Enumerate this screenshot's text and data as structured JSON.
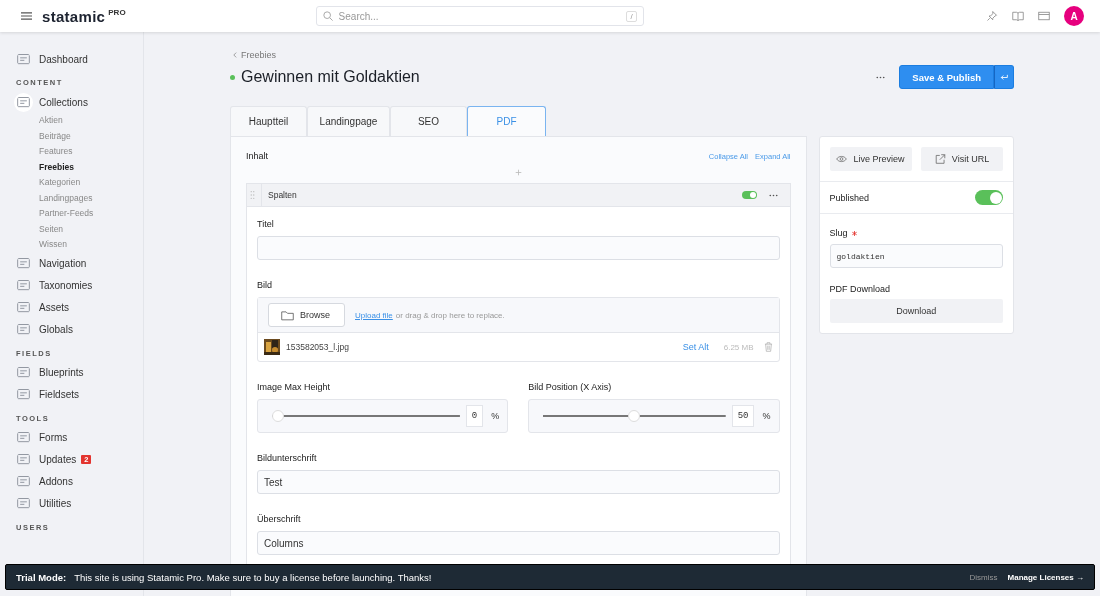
{
  "header": {
    "logo": "statamic",
    "logo_badge": "PRO",
    "search_placeholder": "Search...",
    "search_shortcut": "/",
    "avatar": "A"
  },
  "sidebar": {
    "sections": [
      {
        "items": [
          {
            "label": "Dashboard"
          }
        ]
      },
      {
        "heading": "CONTENT",
        "items": [
          {
            "label": "Collections",
            "expanded": true,
            "children": [
              {
                "label": "Aktien",
                "selected": false
              },
              {
                "label": "Beiträge",
                "selected": false
              },
              {
                "label": "Features",
                "selected": false
              },
              {
                "label": "Freebies",
                "selected": true
              },
              {
                "label": "Kategorien",
                "selected": false
              },
              {
                "label": "Landingpages",
                "selected": false
              },
              {
                "label": "Partner-Feeds",
                "selected": false
              },
              {
                "label": "Seiten",
                "selected": false
              },
              {
                "label": "Wissen",
                "selected": false
              }
            ]
          },
          {
            "label": "Navigation"
          },
          {
            "label": "Taxonomies"
          },
          {
            "label": "Assets"
          },
          {
            "label": "Globals"
          }
        ]
      },
      {
        "heading": "FIELDS",
        "items": [
          {
            "label": "Blueprints"
          },
          {
            "label": "Fieldsets"
          }
        ]
      },
      {
        "heading": "TOOLS",
        "items": [
          {
            "label": "Forms"
          },
          {
            "label": "Updates",
            "badge": "2"
          },
          {
            "label": "Addons"
          },
          {
            "label": "Utilities"
          }
        ]
      },
      {
        "heading": "USERS"
      }
    ]
  },
  "entry": {
    "breadcrumb": "Freebies",
    "title": "Gewinnen mit Goldaktien",
    "published": true,
    "save_label": "Save & Publish"
  },
  "tabs": [
    {
      "label": "Hauptteil",
      "selected": false
    },
    {
      "label": "Landingpage",
      "selected": false
    },
    {
      "label": "SEO",
      "selected": false
    },
    {
      "label": "PDF",
      "selected": true
    }
  ],
  "content": {
    "label": "Inhalt",
    "collapse": "Collapse All",
    "expand": "Expand All",
    "set": {
      "title": "Spalten",
      "enabled": true,
      "fields": [
        {
          "kind": "text",
          "label": "Titel"
        },
        {
          "kind": "assets",
          "label": "Bild",
          "browse": "Browse",
          "upload_link": "Upload file",
          "upload_hint": "or drag & drop here to replace.",
          "file": {
            "name": "153582053_l.jpg",
            "set_alt": "Set Alt",
            "size": "6.25 MB"
          }
        },
        {
          "kind": "range",
          "label": "Image Max Height",
          "level": 0,
          "value": "0",
          "unit": "%"
        },
        {
          "kind": "range",
          "label": "Bild Position (X Axis)",
          "level": 0.5,
          "value": "50",
          "unit": "%"
        },
        {
          "kind": "text",
          "label": "Bildunterschrift",
          "value": "Test"
        },
        {
          "kind": "text",
          "label": "Überschrift",
          "value": "Columns"
        }
      ]
    }
  },
  "side": {
    "live_preview": "Live Preview",
    "visit_url": "Visit URL",
    "published_label": "Published",
    "published_on": true,
    "slug_label": "Slug",
    "slug_required": true,
    "slug_value": "goldaktien",
    "pdf_label": "PDF Download",
    "download": "Download"
  },
  "banner": {
    "title": "Trial Mode:",
    "message": "This site is using Statamic Pro. Make sure to buy a license before launching. Thanks!",
    "dismiss": "Dismiss",
    "manage": "Manage Licenses →"
  }
}
